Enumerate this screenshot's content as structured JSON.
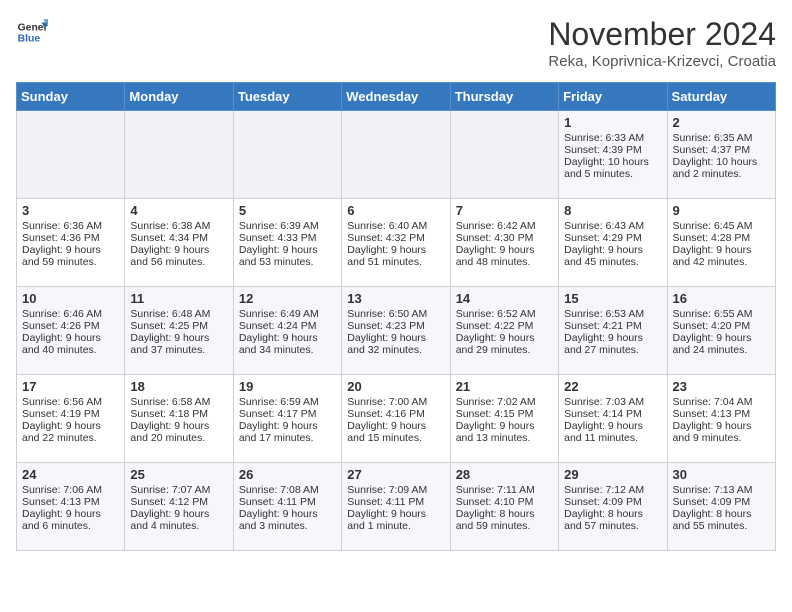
{
  "header": {
    "logo_general": "General",
    "logo_blue": "Blue",
    "month": "November 2024",
    "location": "Reka, Koprivnica-Krizevci, Croatia"
  },
  "days_of_week": [
    "Sunday",
    "Monday",
    "Tuesday",
    "Wednesday",
    "Thursday",
    "Friday",
    "Saturday"
  ],
  "weeks": [
    [
      {
        "day": "",
        "info": ""
      },
      {
        "day": "",
        "info": ""
      },
      {
        "day": "",
        "info": ""
      },
      {
        "day": "",
        "info": ""
      },
      {
        "day": "",
        "info": ""
      },
      {
        "day": "1",
        "info": "Sunrise: 6:33 AM\nSunset: 4:39 PM\nDaylight: 10 hours and 5 minutes."
      },
      {
        "day": "2",
        "info": "Sunrise: 6:35 AM\nSunset: 4:37 PM\nDaylight: 10 hours and 2 minutes."
      }
    ],
    [
      {
        "day": "3",
        "info": "Sunrise: 6:36 AM\nSunset: 4:36 PM\nDaylight: 9 hours and 59 minutes."
      },
      {
        "day": "4",
        "info": "Sunrise: 6:38 AM\nSunset: 4:34 PM\nDaylight: 9 hours and 56 minutes."
      },
      {
        "day": "5",
        "info": "Sunrise: 6:39 AM\nSunset: 4:33 PM\nDaylight: 9 hours and 53 minutes."
      },
      {
        "day": "6",
        "info": "Sunrise: 6:40 AM\nSunset: 4:32 PM\nDaylight: 9 hours and 51 minutes."
      },
      {
        "day": "7",
        "info": "Sunrise: 6:42 AM\nSunset: 4:30 PM\nDaylight: 9 hours and 48 minutes."
      },
      {
        "day": "8",
        "info": "Sunrise: 6:43 AM\nSunset: 4:29 PM\nDaylight: 9 hours and 45 minutes."
      },
      {
        "day": "9",
        "info": "Sunrise: 6:45 AM\nSunset: 4:28 PM\nDaylight: 9 hours and 42 minutes."
      }
    ],
    [
      {
        "day": "10",
        "info": "Sunrise: 6:46 AM\nSunset: 4:26 PM\nDaylight: 9 hours and 40 minutes."
      },
      {
        "day": "11",
        "info": "Sunrise: 6:48 AM\nSunset: 4:25 PM\nDaylight: 9 hours and 37 minutes."
      },
      {
        "day": "12",
        "info": "Sunrise: 6:49 AM\nSunset: 4:24 PM\nDaylight: 9 hours and 34 minutes."
      },
      {
        "day": "13",
        "info": "Sunrise: 6:50 AM\nSunset: 4:23 PM\nDaylight: 9 hours and 32 minutes."
      },
      {
        "day": "14",
        "info": "Sunrise: 6:52 AM\nSunset: 4:22 PM\nDaylight: 9 hours and 29 minutes."
      },
      {
        "day": "15",
        "info": "Sunrise: 6:53 AM\nSunset: 4:21 PM\nDaylight: 9 hours and 27 minutes."
      },
      {
        "day": "16",
        "info": "Sunrise: 6:55 AM\nSunset: 4:20 PM\nDaylight: 9 hours and 24 minutes."
      }
    ],
    [
      {
        "day": "17",
        "info": "Sunrise: 6:56 AM\nSunset: 4:19 PM\nDaylight: 9 hours and 22 minutes."
      },
      {
        "day": "18",
        "info": "Sunrise: 6:58 AM\nSunset: 4:18 PM\nDaylight: 9 hours and 20 minutes."
      },
      {
        "day": "19",
        "info": "Sunrise: 6:59 AM\nSunset: 4:17 PM\nDaylight: 9 hours and 17 minutes."
      },
      {
        "day": "20",
        "info": "Sunrise: 7:00 AM\nSunset: 4:16 PM\nDaylight: 9 hours and 15 minutes."
      },
      {
        "day": "21",
        "info": "Sunrise: 7:02 AM\nSunset: 4:15 PM\nDaylight: 9 hours and 13 minutes."
      },
      {
        "day": "22",
        "info": "Sunrise: 7:03 AM\nSunset: 4:14 PM\nDaylight: 9 hours and 11 minutes."
      },
      {
        "day": "23",
        "info": "Sunrise: 7:04 AM\nSunset: 4:13 PM\nDaylight: 9 hours and 9 minutes."
      }
    ],
    [
      {
        "day": "24",
        "info": "Sunrise: 7:06 AM\nSunset: 4:13 PM\nDaylight: 9 hours and 6 minutes."
      },
      {
        "day": "25",
        "info": "Sunrise: 7:07 AM\nSunset: 4:12 PM\nDaylight: 9 hours and 4 minutes."
      },
      {
        "day": "26",
        "info": "Sunrise: 7:08 AM\nSunset: 4:11 PM\nDaylight: 9 hours and 3 minutes."
      },
      {
        "day": "27",
        "info": "Sunrise: 7:09 AM\nSunset: 4:11 PM\nDaylight: 9 hours and 1 minute."
      },
      {
        "day": "28",
        "info": "Sunrise: 7:11 AM\nSunset: 4:10 PM\nDaylight: 8 hours and 59 minutes."
      },
      {
        "day": "29",
        "info": "Sunrise: 7:12 AM\nSunset: 4:09 PM\nDaylight: 8 hours and 57 minutes."
      },
      {
        "day": "30",
        "info": "Sunrise: 7:13 AM\nSunset: 4:09 PM\nDaylight: 8 hours and 55 minutes."
      }
    ]
  ]
}
